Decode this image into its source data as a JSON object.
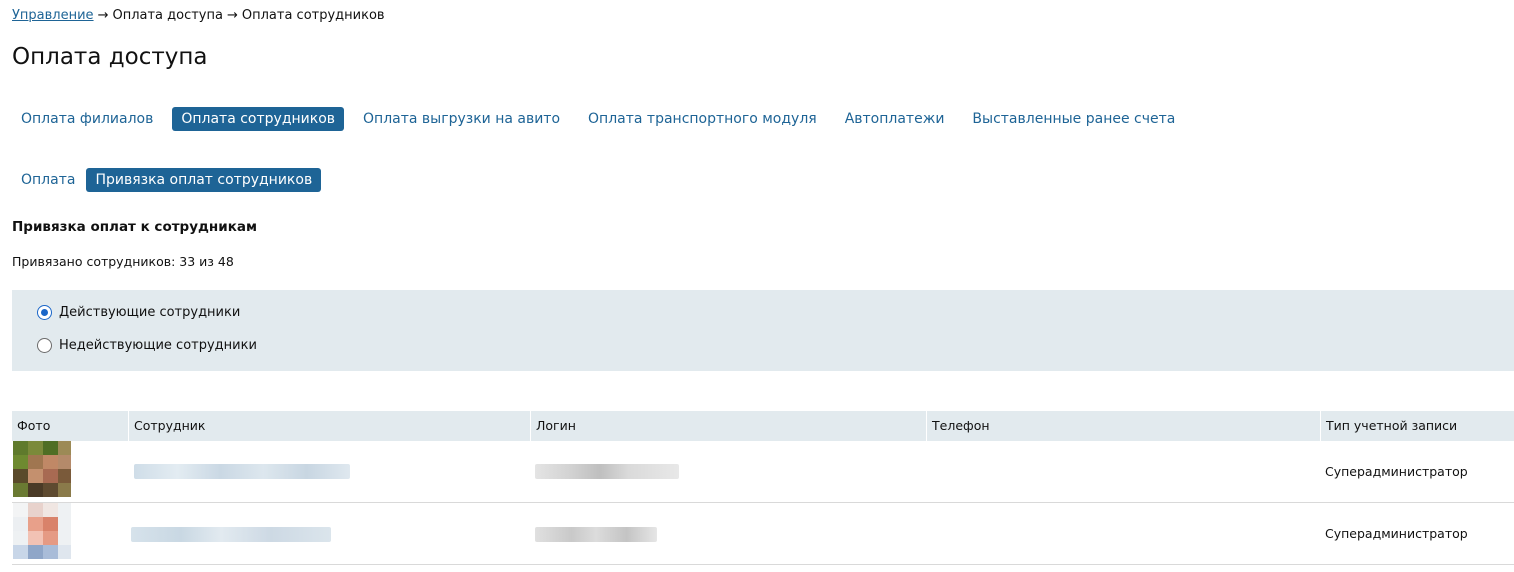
{
  "breadcrumb": {
    "items": [
      "Управление",
      "Оплата доступа",
      "Оплата сотрудников"
    ],
    "separator": "→"
  },
  "page_title": "Оплата доступа",
  "main_tabs": [
    {
      "label": "Оплата филиалов",
      "active": false
    },
    {
      "label": "Оплата сотрудников",
      "active": true
    },
    {
      "label": "Оплата выгрузки на авито",
      "active": false
    },
    {
      "label": "Оплата транспортного модуля",
      "active": false
    },
    {
      "label": "Автоплатежи",
      "active": false
    },
    {
      "label": "Выставленные ранее счета",
      "active": false
    }
  ],
  "sub_tabs": [
    {
      "label": "Оплата",
      "active": false
    },
    {
      "label": "Привязка оплат сотрудников",
      "active": true
    }
  ],
  "section_title": "Привязка оплат к сотрудникам",
  "counter_text": "Привязано сотрудников: 33 из 48",
  "filter": {
    "options": [
      {
        "label": "Действующие сотрудники",
        "checked": true
      },
      {
        "label": "Недействующие сотрудники",
        "checked": false
      }
    ]
  },
  "table": {
    "columns": [
      "Фото",
      "Сотрудник",
      "Логин",
      "Телефон",
      "Тип учетной записи"
    ],
    "rows": [
      {
        "account_type": "Суперадминистратор"
      },
      {
        "account_type": "Суперадминистратор"
      }
    ]
  },
  "colors": {
    "accent": "#1e6496",
    "panel_bg": "#e2eaee",
    "radio_checked": "#1a66c8"
  }
}
